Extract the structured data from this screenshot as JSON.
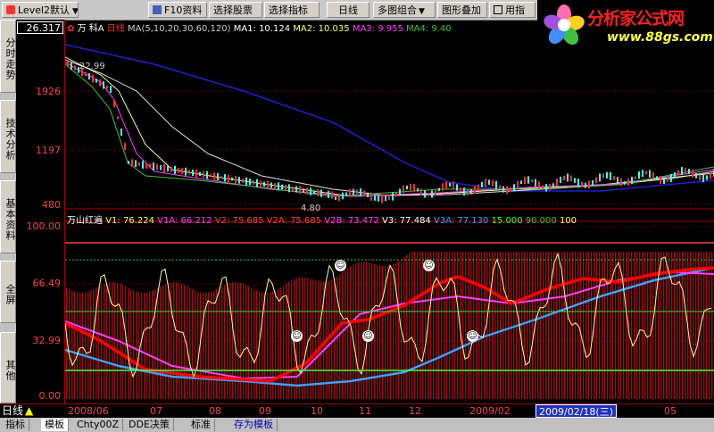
{
  "toolbar": {
    "items": [
      {
        "label": "Level2默认"
      },
      {
        "label": "F10资料"
      },
      {
        "label": "选择股票"
      },
      {
        "label": "选择指标"
      },
      {
        "label": "日线"
      },
      {
        "label": "多图组合"
      },
      {
        "label": "图形叠加"
      },
      {
        "label": "用指"
      }
    ]
  },
  "left_tabs": [
    "分时走势",
    "技术分析",
    "基本资料",
    "全屏",
    "其他"
  ],
  "price_box": "26.317",
  "price_axis": [
    "1926",
    "1197",
    "480"
  ],
  "indicator_axis": [
    "100.00",
    "66.49",
    "32.99",
    "0.00"
  ],
  "price_legend": {
    "stock": "万 科A",
    "period": "日线",
    "ma_def": "MA(5,10,20,30,60,120)",
    "ma1": "MA1: 10.124",
    "ma2": "MA2: 10.035",
    "ma3": "MA3: 9.955",
    "ma4": "MA4: 9.40"
  },
  "annotations": {
    "high": "22.99",
    "low": "4.80"
  },
  "indicator_legend": {
    "name": "万山红遍",
    "v1": "V1: 76.224",
    "v1a": "V1A: 66.212",
    "v2": "V2: 75.685",
    "v2a": "V2A: 75.685",
    "v2b": "V2B: 73.472",
    "v3": "V3: 77.484",
    "v3a": "V3A: 77.130",
    "c15": "15.000",
    "c90": "90.000",
    "c100": "100"
  },
  "xaxis": {
    "period_label": "日线",
    "labels": [
      "2008/06",
      "07",
      "08",
      "09",
      "10",
      "11",
      "12",
      "2009/02",
      "05"
    ],
    "cursor_date": "2009/02/18(三)"
  },
  "bottom_tabs": [
    "指标",
    "模板",
    "Chty00Z",
    "DDE决策",
    "标准",
    "存为模板"
  ],
  "logo": {
    "title": "分析家公式网",
    "url": "www.88gs.com"
  },
  "colors": {
    "up": "#ff3030",
    "axis": "#a00000",
    "ma_blue": "#2020d0",
    "ma_white": "#ffffff",
    "ma_yellow": "#ffff66",
    "ma_magenta": "#ff40ff",
    "ma_green": "#40c040",
    "ma_cyan": "#40a0ff"
  }
}
